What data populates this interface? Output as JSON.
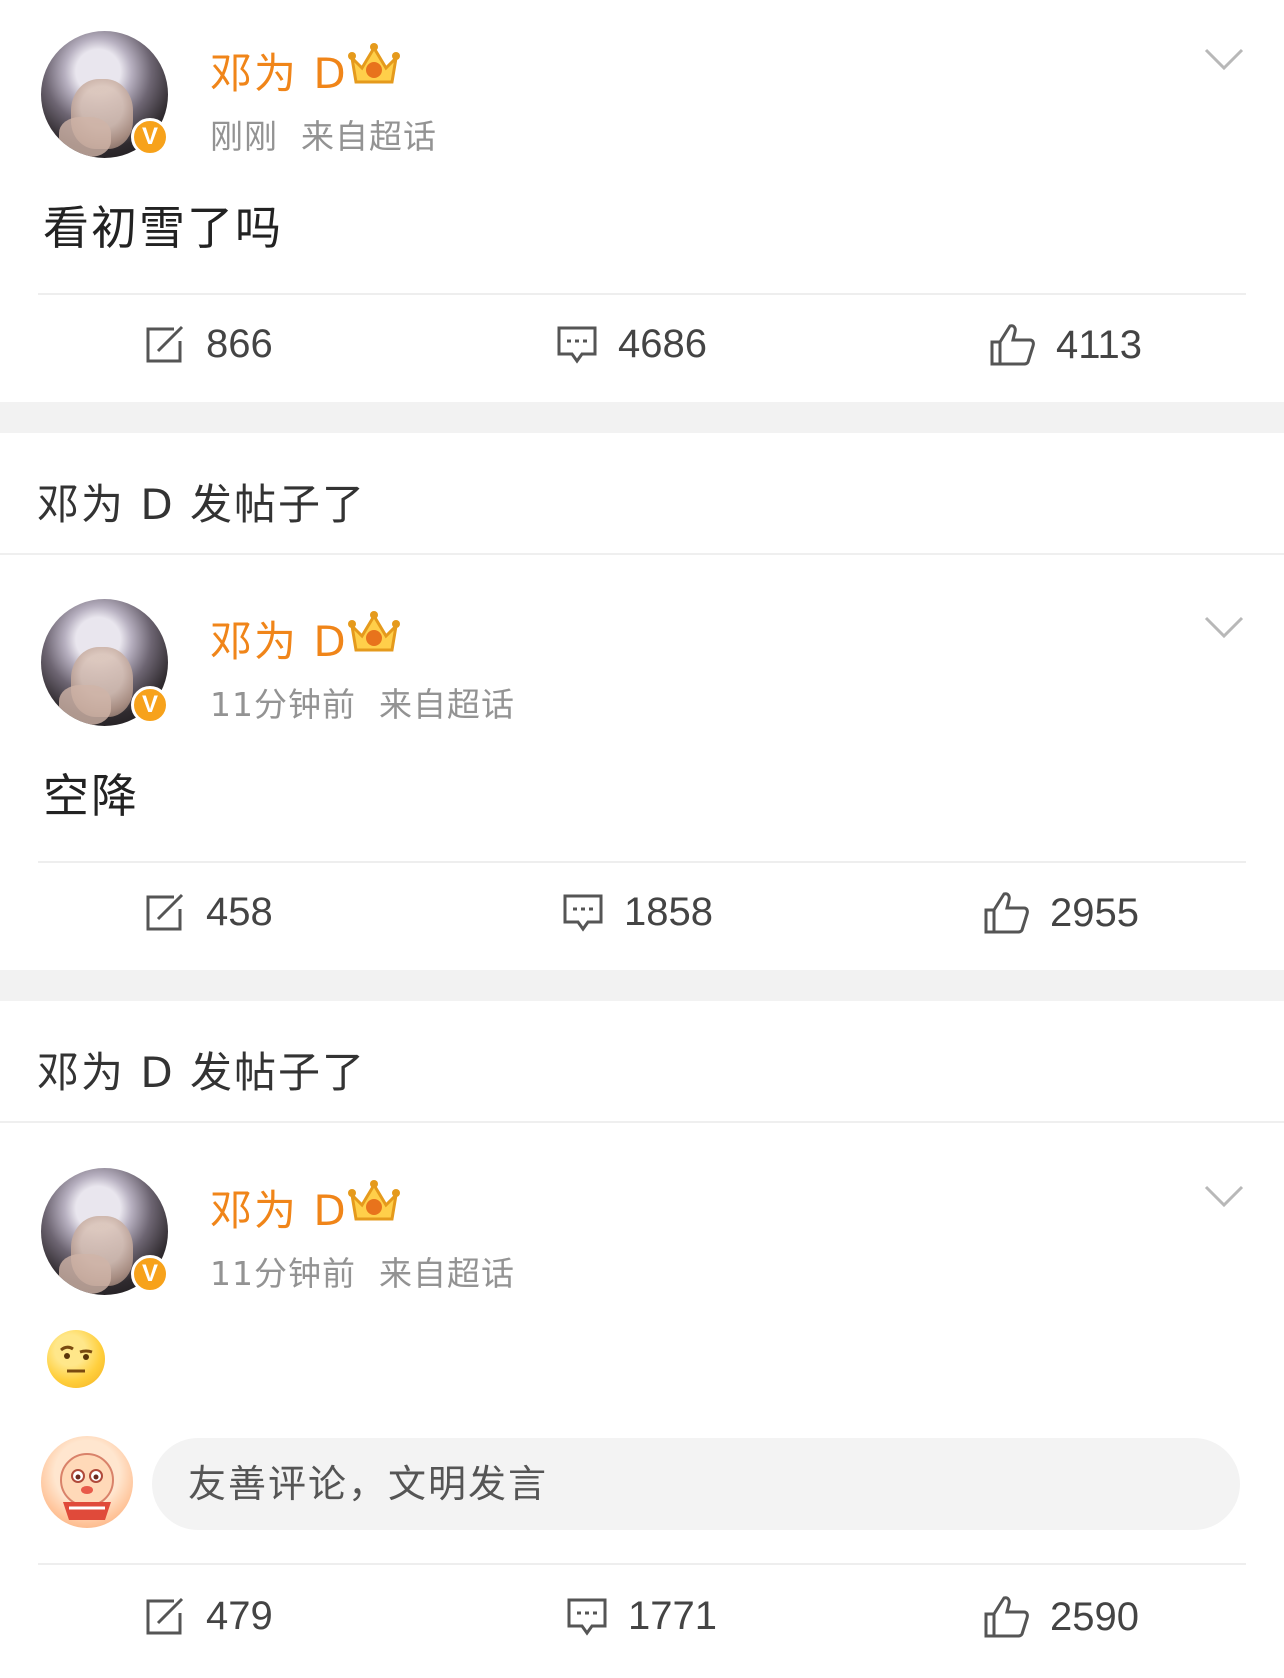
{
  "posts": [
    {
      "username": "邓为 D",
      "time": "刚刚",
      "source": "来自超话",
      "content": "看初雪了吗",
      "reposts": "866",
      "comments": "4686",
      "likes": "4113"
    },
    {
      "section_title": "邓为 D 发帖子了",
      "username": "邓为 D",
      "time": "11分钟前",
      "source": "来自超话",
      "content": "空降",
      "reposts": "458",
      "comments": "1858",
      "likes": "2955"
    },
    {
      "section_title": "邓为 D 发帖子了",
      "username": "邓为 D",
      "time": "11分钟前",
      "source": "来自超话",
      "content_emoji": "raised-eyebrow-emoji",
      "comment_placeholder": "友善评论，文明发言",
      "reposts": "479",
      "comments": "1771",
      "likes": "2590"
    }
  ],
  "badge_letter": "V",
  "icons": [
    "repost-icon",
    "comment-icon",
    "like-icon",
    "crown-icon",
    "chevron-down-icon",
    "verified-badge"
  ],
  "colors": {
    "username": "#f08519",
    "badge": "#f7a21b",
    "meta": "#939393"
  }
}
